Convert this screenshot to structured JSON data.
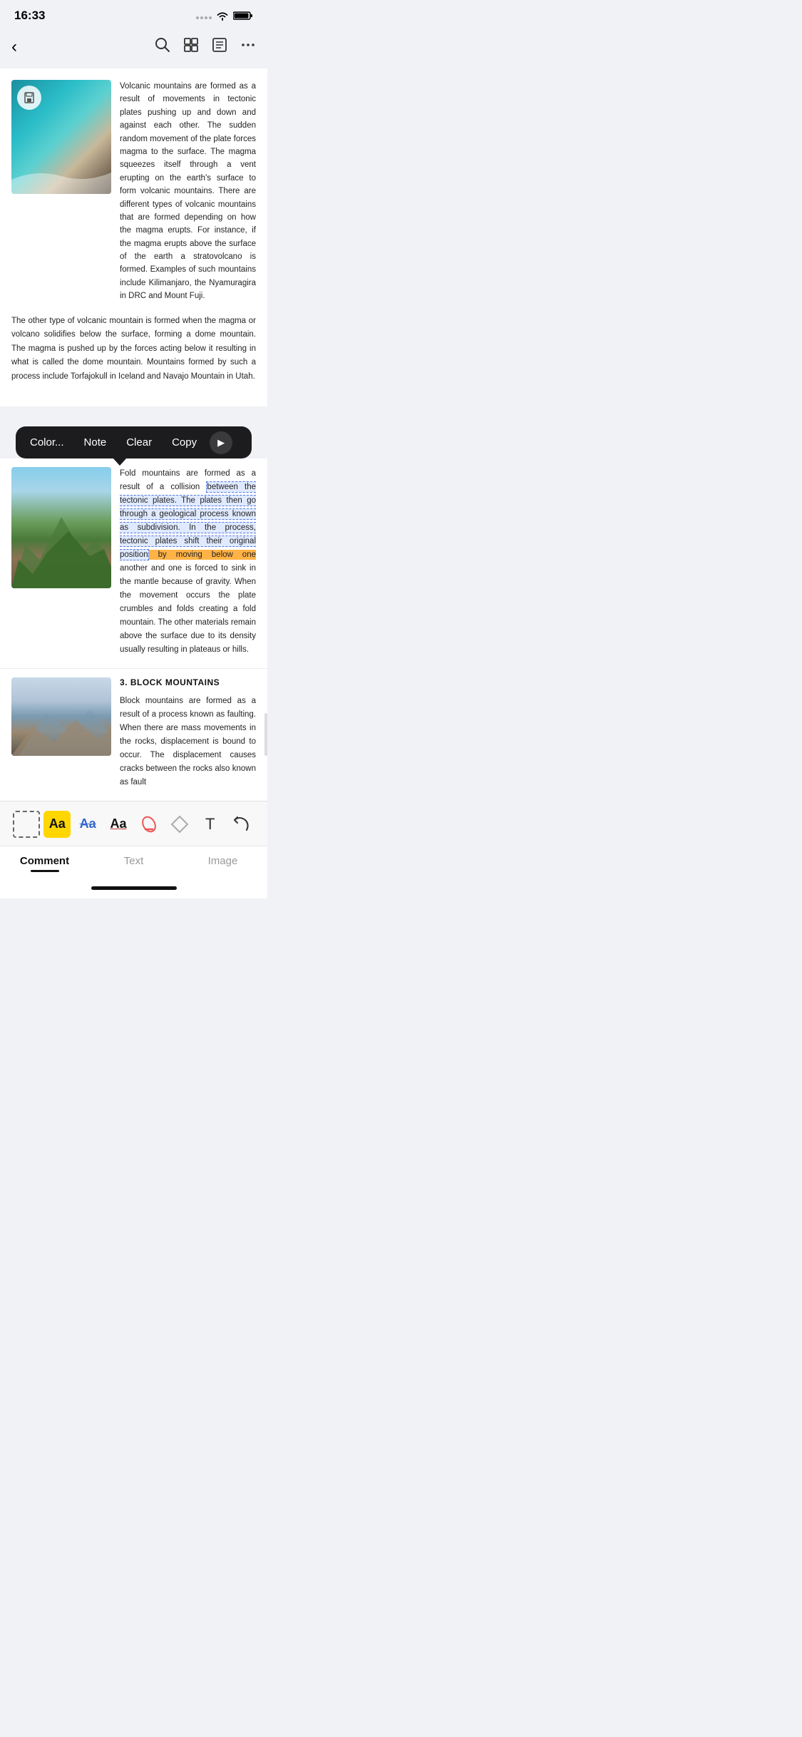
{
  "statusBar": {
    "time": "16:33"
  },
  "nav": {
    "backLabel": "‹",
    "searchIcon": "search",
    "gridIcon": "grid",
    "listIcon": "list",
    "moreIcon": "more"
  },
  "article": {
    "section1Text": "Volcanic mountains are formed as a result of movements in tectonic plates pushing up and down and against each other. The sudden random movement of the plate forces magma to the surface. The magma squeezes itself through a vent erupting on the earth's surface to form volcanic mountains. There are different types of volcanic mountains that are formed depending on how the magma erupts. For instance, if the magma erupts above the surface of the earth a stratovolcano is formed. Examples of such mountains include Kilimanjaro, the Nyamuragira in DRC and Mount Fuji.",
    "section2Text": "The other type of volcanic mountain is formed when the magma or volcano solidifies below the surface, forming a dome mountain. The magma is pushed up by the forces acting below it resulting in what is called the dome mountain. Mountains formed by such a process include Torfajokull in Iceland and Navajo Mountain in Utah.",
    "foldText1": "Fold mountains are formed as a result of a collision between the tectonic plates. The plates then go through a geological process known as subdivision. In the process, tectonic plates shift their original position by moving below one another and one is forced to sink in the mantle because of gravity. When the movement occurs the plate crumbles and folds creating a fold mountain. The other materials remain above the surface due to its density usually resulting in plateaus or hills.",
    "blockHeading": "3. BLOCK MOUNTAINS",
    "blockText": "Block mountains are formed as a result of a process known as faulting. When there are mass movements in the rocks, displacement is bound to occur. The displacement causes cracks between the rocks also known as fault"
  },
  "popup": {
    "colorLabel": "Color...",
    "noteLabel": "Note",
    "clearLabel": "Clear",
    "copyLabel": "Copy",
    "arrowIcon": "▶"
  },
  "toolbar": {
    "selectIcon": "select",
    "textHighlightIcon": "Aa",
    "textStrikeIcon": "Aa",
    "textUnderlineIcon": "Aa",
    "eraserIcon": "eraser",
    "diamondIcon": "diamond",
    "tIcon": "T",
    "undoIcon": "undo"
  },
  "tabs": {
    "items": [
      {
        "label": "Comment",
        "active": true
      },
      {
        "label": "Text",
        "active": false
      },
      {
        "label": "Image",
        "active": false
      }
    ]
  }
}
